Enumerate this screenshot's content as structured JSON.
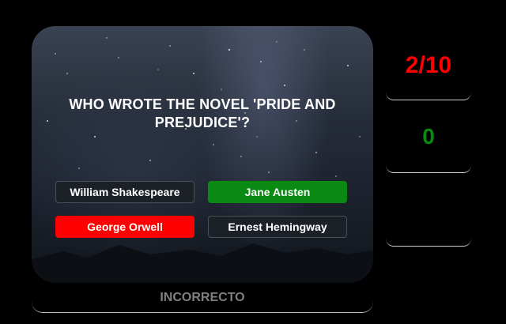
{
  "question": {
    "text": "WHO WROTE THE NOVEL 'PRIDE AND PREJUDICE'?"
  },
  "answers": [
    {
      "label": "William Shakespeare",
      "state": "neutral"
    },
    {
      "label": "Jane Austen",
      "state": "correct"
    },
    {
      "label": "George Orwell",
      "state": "wrong"
    },
    {
      "label": "Ernest Hemingway",
      "state": "neutral"
    }
  ],
  "feedback": {
    "text": "INCORRECTO"
  },
  "sidebar": {
    "progress": "2/10",
    "score": "0"
  },
  "colors": {
    "correct": "#0a8a12",
    "wrong": "#ff0000",
    "feedback_text": "#808080"
  }
}
